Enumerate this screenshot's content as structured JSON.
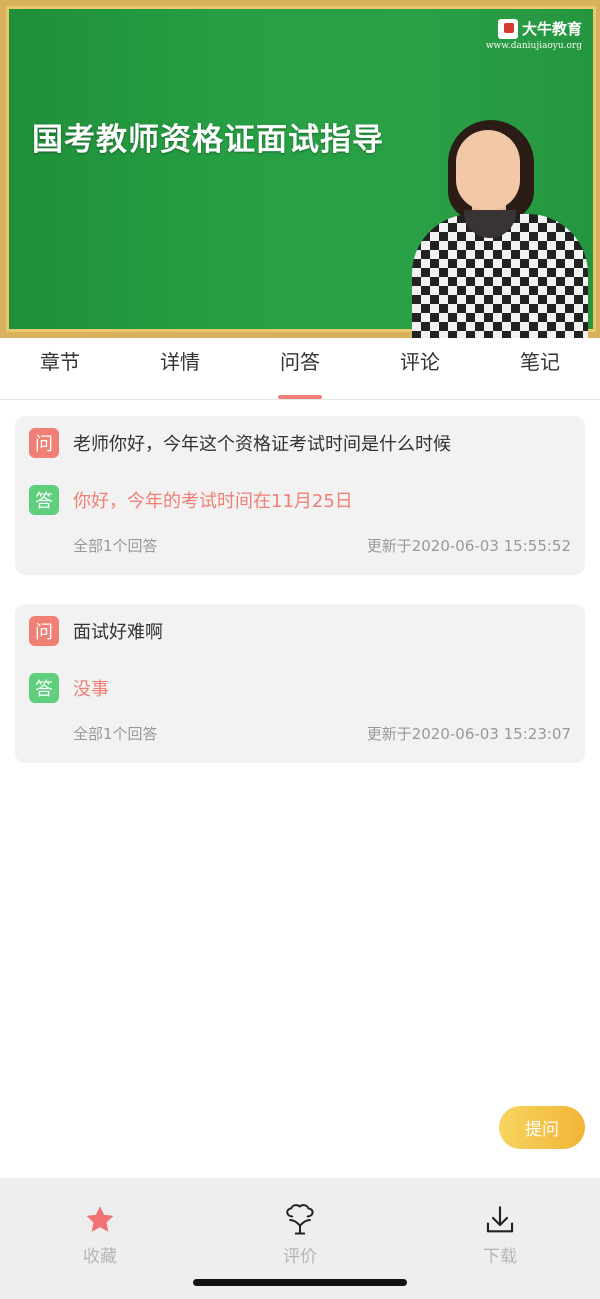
{
  "video": {
    "title": "国考教师资格证面试指导",
    "brand_name": "大牛教育",
    "brand_url": "www.daniujiaoyu.org"
  },
  "tabs": [
    {
      "label": "章节"
    },
    {
      "label": "详情"
    },
    {
      "label": "问答",
      "active": true
    },
    {
      "label": "评论"
    },
    {
      "label": "笔记"
    }
  ],
  "qa": [
    {
      "q_badge": "问",
      "question": "老师你好，今年这个资格证考试时间是什么时候",
      "a_badge": "答",
      "answer": "你好，今年的考试时间在11月25日",
      "count": "全部1个回答",
      "updated": "更新于2020-06-03 15:55:52"
    },
    {
      "q_badge": "问",
      "question": "面试好难啊",
      "a_badge": "答",
      "answer": "没事",
      "count": "全部1个回答",
      "updated": "更新于2020-06-03 15:23:07"
    }
  ],
  "ask_button": "提问",
  "bottom_bar": [
    {
      "label": "收藏",
      "icon": "star-icon"
    },
    {
      "label": "评价",
      "icon": "rating-icon"
    },
    {
      "label": "下载",
      "icon": "download-icon"
    }
  ],
  "colors": {
    "accent": "#f07f76",
    "answer_badge": "#5fcf7e",
    "ask_button": "#f2c04a"
  }
}
